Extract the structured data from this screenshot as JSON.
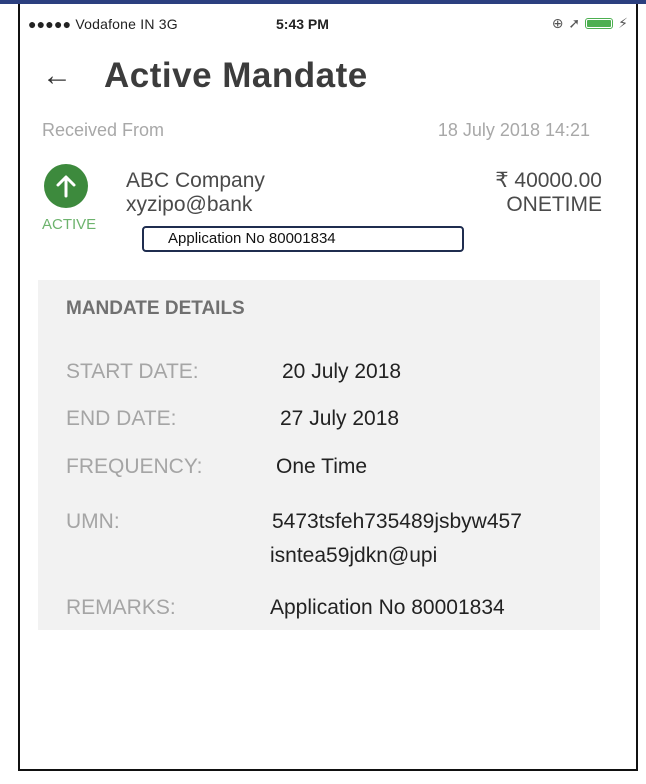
{
  "status_bar": {
    "carrier": "●●●●● Vodafone IN  3G",
    "time": "5:43 PM",
    "icons": [
      "location-icon",
      "navigation-arrow-icon",
      "battery-icon"
    ]
  },
  "header": {
    "back_icon": "←",
    "title": "Active Mandate"
  },
  "mandate": {
    "received_label": "Received From",
    "date": "18 July 2018 14:21",
    "status_icon": "↑",
    "status_label": "ACTIVE",
    "company": "ABC Company",
    "email": "xyzipo@bank",
    "amount": "₹ 40000.00",
    "type": "ONETIME",
    "application_no": "Application No 80001834"
  },
  "details": {
    "title": "MANDATE DETAILS",
    "start_label": "START DATE:",
    "start_value": "20 July 2018",
    "end_label": "END DATE:",
    "end_value": "27 July 2018",
    "frequency_label": "FREQUENCY:",
    "frequency_value": "One Time",
    "umn_label": "UMN:",
    "umn_value_line1": "5473tsfeh735489jsbyw457",
    "umn_value_line2": "isntea59jdkn@upi",
    "remarks_label": "REMARKS:",
    "remarks_value": "Application No 80001834"
  },
  "colors": {
    "accent_green": "#3d8a3d",
    "active_green": "#6db36d",
    "box_border": "#1f2d4f",
    "panel_bg": "#f2f2f2"
  }
}
